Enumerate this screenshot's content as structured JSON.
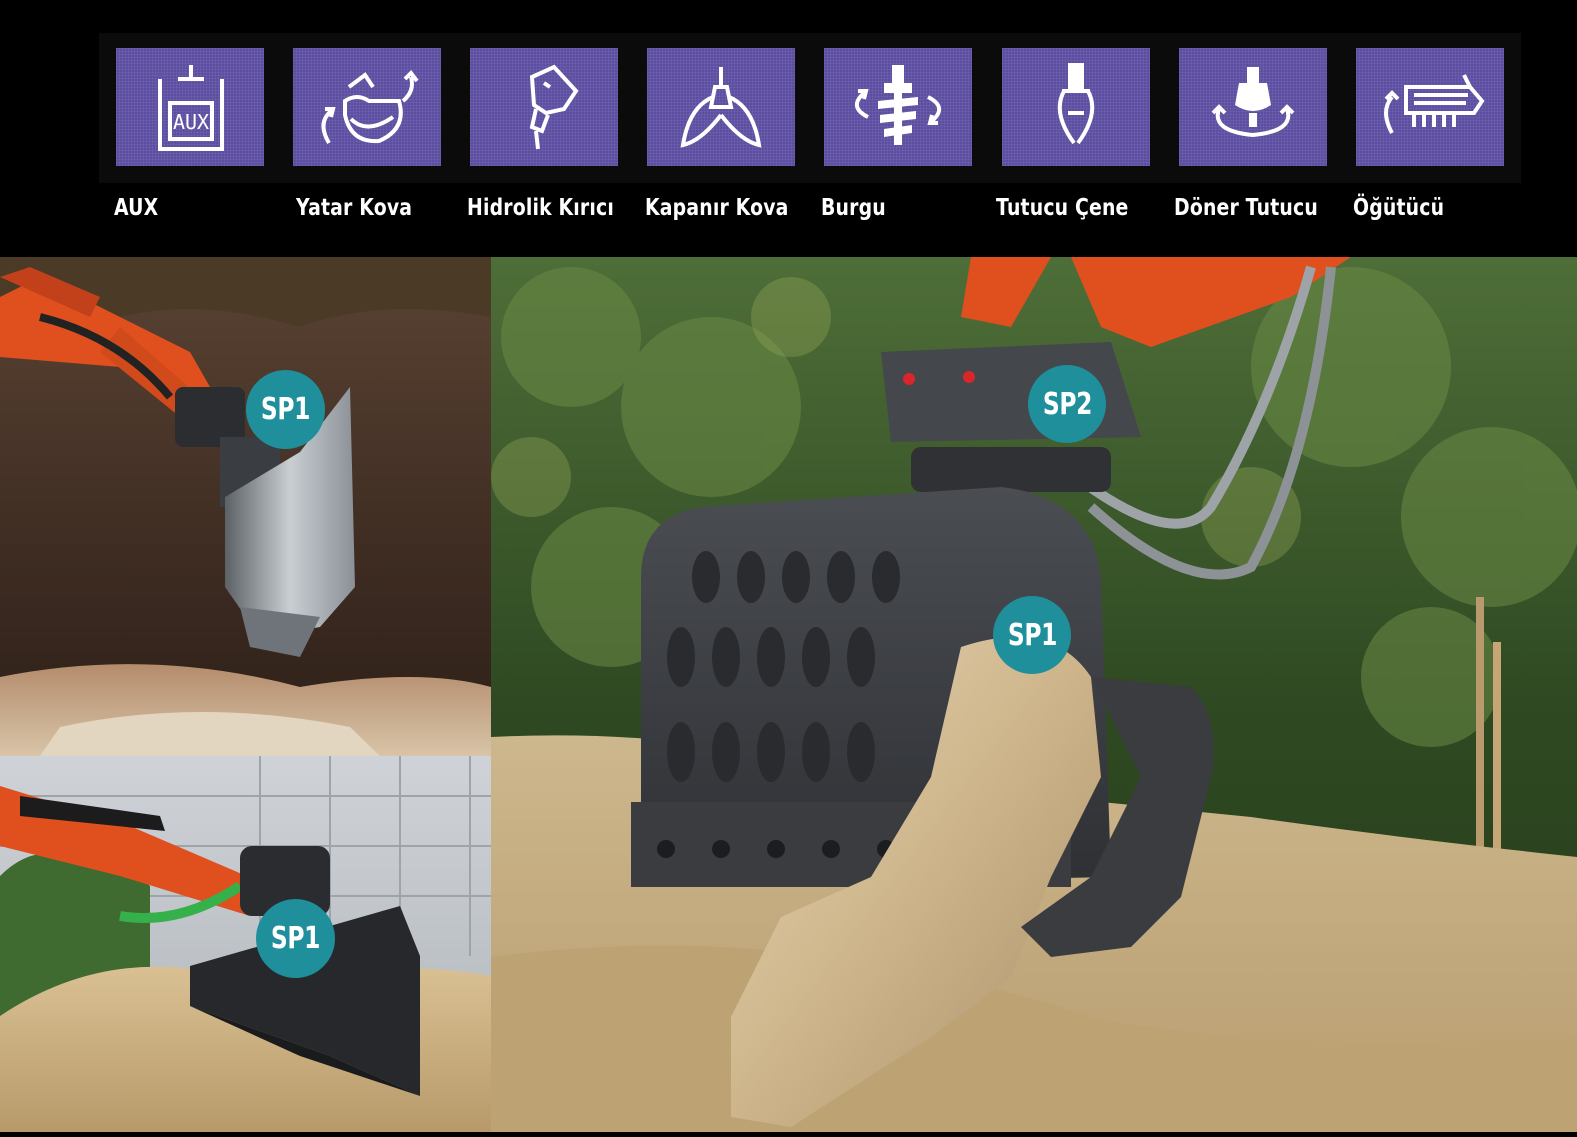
{
  "attachments": [
    {
      "label": "AUX",
      "icon": "aux-icon"
    },
    {
      "label": "Yatar Kova",
      "icon": "tilt-bucket-icon"
    },
    {
      "label": "Hidrolik Kırıcı",
      "icon": "hydraulic-breaker-icon"
    },
    {
      "label": "Kapanır Kova",
      "icon": "clamshell-bucket-icon"
    },
    {
      "label": "Burgu",
      "icon": "auger-icon"
    },
    {
      "label": "Tutucu Çene",
      "icon": "grapple-jaw-icon"
    },
    {
      "label": "Döner Tutucu",
      "icon": "rotating-grapple-icon"
    },
    {
      "label": "Öğütücü",
      "icon": "mulcher-icon"
    }
  ],
  "aux_icon_text": "AUX",
  "badges": {
    "top_left": "SP1",
    "bottom_left": "SP1",
    "main_upper": "SP2",
    "main_lower": "SP1"
  },
  "colors": {
    "tile": "#5c4ea0",
    "badge": "#1e8f9b",
    "machine_orange": "#e0501e",
    "attachment_grey": "#3a3d42"
  }
}
